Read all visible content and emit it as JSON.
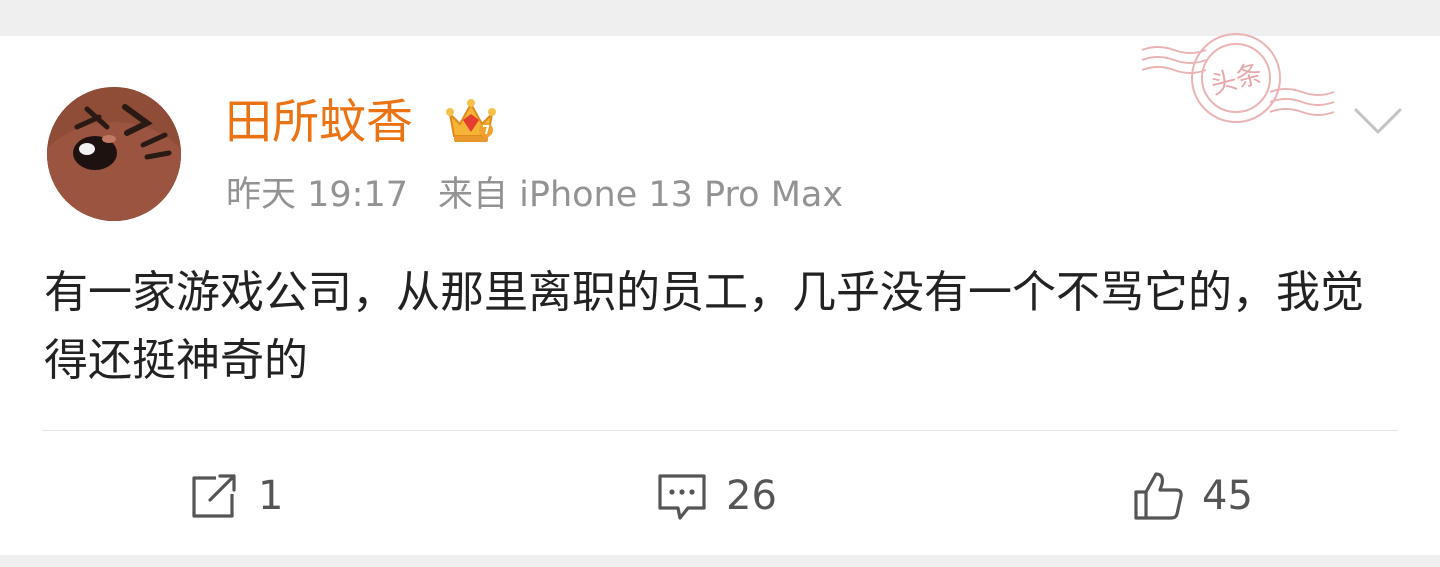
{
  "post": {
    "user": {
      "name": "田所蚊香",
      "avatar_icon": "avatar-anime-face",
      "badge_icon": "crown-icon"
    },
    "meta": {
      "time": "昨天 19:17",
      "source": "来自 iPhone 13 Pro Max"
    },
    "stamp_text": "头条",
    "menu_icon": "chevron-down-icon",
    "content": "有一家游戏公司，从那里离职的员工，几乎没有一个不骂它的，我觉得还挺神奇的",
    "actions": {
      "repost": {
        "icon": "share-icon",
        "count": "1"
      },
      "comment": {
        "icon": "comment-icon",
        "count": "26"
      },
      "like": {
        "icon": "thumbs-up-icon",
        "count": "45"
      }
    }
  },
  "colors": {
    "username": "#eb7314",
    "meta": "#939393",
    "content": "#222222",
    "stamp": "#e8a8a8",
    "background_gap": "#efefef"
  }
}
